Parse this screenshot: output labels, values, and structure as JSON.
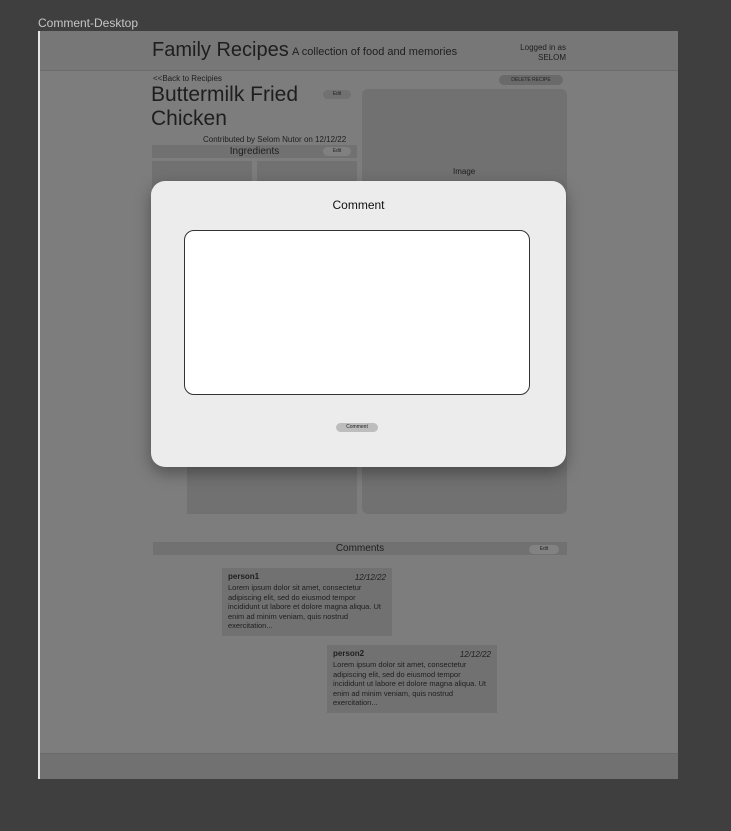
{
  "frame_label": "Comment-Desktop",
  "app": {
    "title": "Family Recipes",
    "tagline": "A collection of food and memories",
    "logged_in_line1": "Logged in as",
    "logged_in_user": "SELOM"
  },
  "recipe": {
    "back_link": "<<Back to Recipies",
    "delete_label": "DELETE RECIPE",
    "title": "Buttermilk Fried Chicken",
    "edit_label": "Edit",
    "contributed": "Contributed by Selom Nutor on 12/12/22",
    "ingredients_label": "Ingredients",
    "ingredients_edit_label": "Edit",
    "image_label": "Image"
  },
  "comments_section": {
    "label": "Comments",
    "edit_label": "Edit",
    "items": [
      {
        "name": "person1",
        "date": "12/12/22",
        "body": "Lorem ipsum dolor sit amet, consectetur adipiscing elit, sed do eiusmod tempor incididunt ut labore et dolore magna aliqua. Ut enim ad minim veniam, quis nostrud exercitation..."
      },
      {
        "name": "person2",
        "date": "12/12/22",
        "body": "Lorem ipsum dolor sit amet, consectetur adipiscing elit, sed do eiusmod tempor incididunt ut labore et dolore magna aliqua. Ut enim ad minim veniam, quis nostrud exercitation..."
      }
    ]
  },
  "modal": {
    "title": "Comment",
    "textarea_value": "",
    "submit_label": "Comment"
  }
}
